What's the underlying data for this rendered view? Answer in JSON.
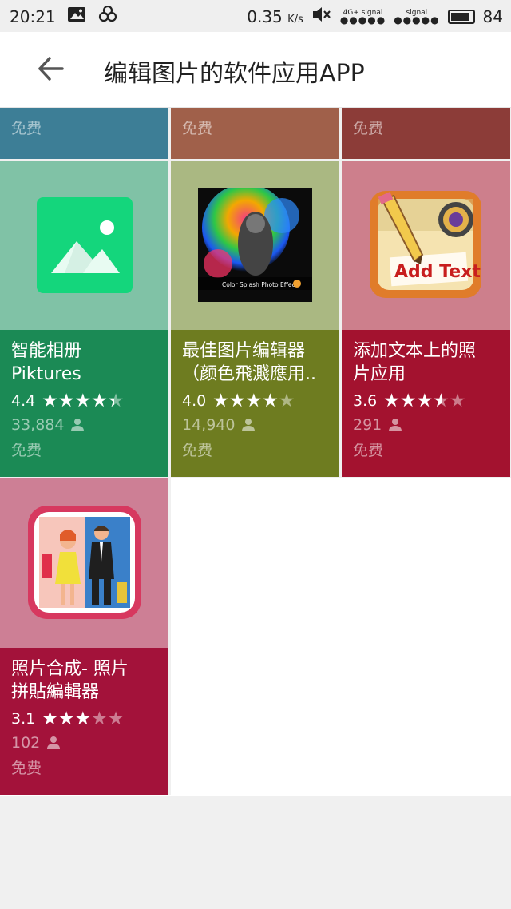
{
  "status_bar": {
    "time": "20:21",
    "speed": "0.35",
    "speed_unit": "K/s",
    "sim1_label": "4G+ signal",
    "sim2_label": "signal",
    "battery": "84",
    "icons": [
      "image-notification-icon",
      "cloud-sync-icon",
      "mute-icon",
      "battery-icon"
    ]
  },
  "app_bar": {
    "title": "编辑图片的软件应用APP",
    "back_icon": "back-arrow-icon"
  },
  "partial_row": [
    {
      "price": "免费",
      "color": "#3d7e96"
    },
    {
      "price": "免费",
      "color": "#a0604a"
    },
    {
      "price": "免费",
      "color": "#8c3c38"
    }
  ],
  "apps": [
    {
      "title": "智能相册\nPiktures",
      "rating": "4.4",
      "rating_value": 4.4,
      "count": "33,884",
      "price": "免费",
      "top_color": "#80c2a6",
      "bottom_color": "#1b8a55",
      "icon": "gallery-icon"
    },
    {
      "title": "最佳图片编辑器\n（颜色飛濺應用..",
      "rating": "4.0",
      "rating_value": 4.0,
      "count": "14,940",
      "price": "免费",
      "top_color": "#aab882",
      "bottom_color": "#6e7c20",
      "icon": "color-splash-icon",
      "icon_caption": "Color Splash Photo Effect"
    },
    {
      "title": "添加文本上的照\n片应用",
      "rating": "3.6",
      "rating_value": 3.6,
      "count": "291",
      "price": "免费",
      "top_color": "#cd7f8c",
      "bottom_color": "#a3122f",
      "icon": "add-text-icon",
      "icon_caption": "Add Text"
    },
    {
      "title": "照片合成- 照片\n拼貼編輯器",
      "rating": "3.1",
      "rating_value": 3.1,
      "count": "102",
      "price": "免费",
      "top_color": "#cd7f95",
      "bottom_color": "#a3123a",
      "icon": "photo-collage-icon"
    }
  ]
}
